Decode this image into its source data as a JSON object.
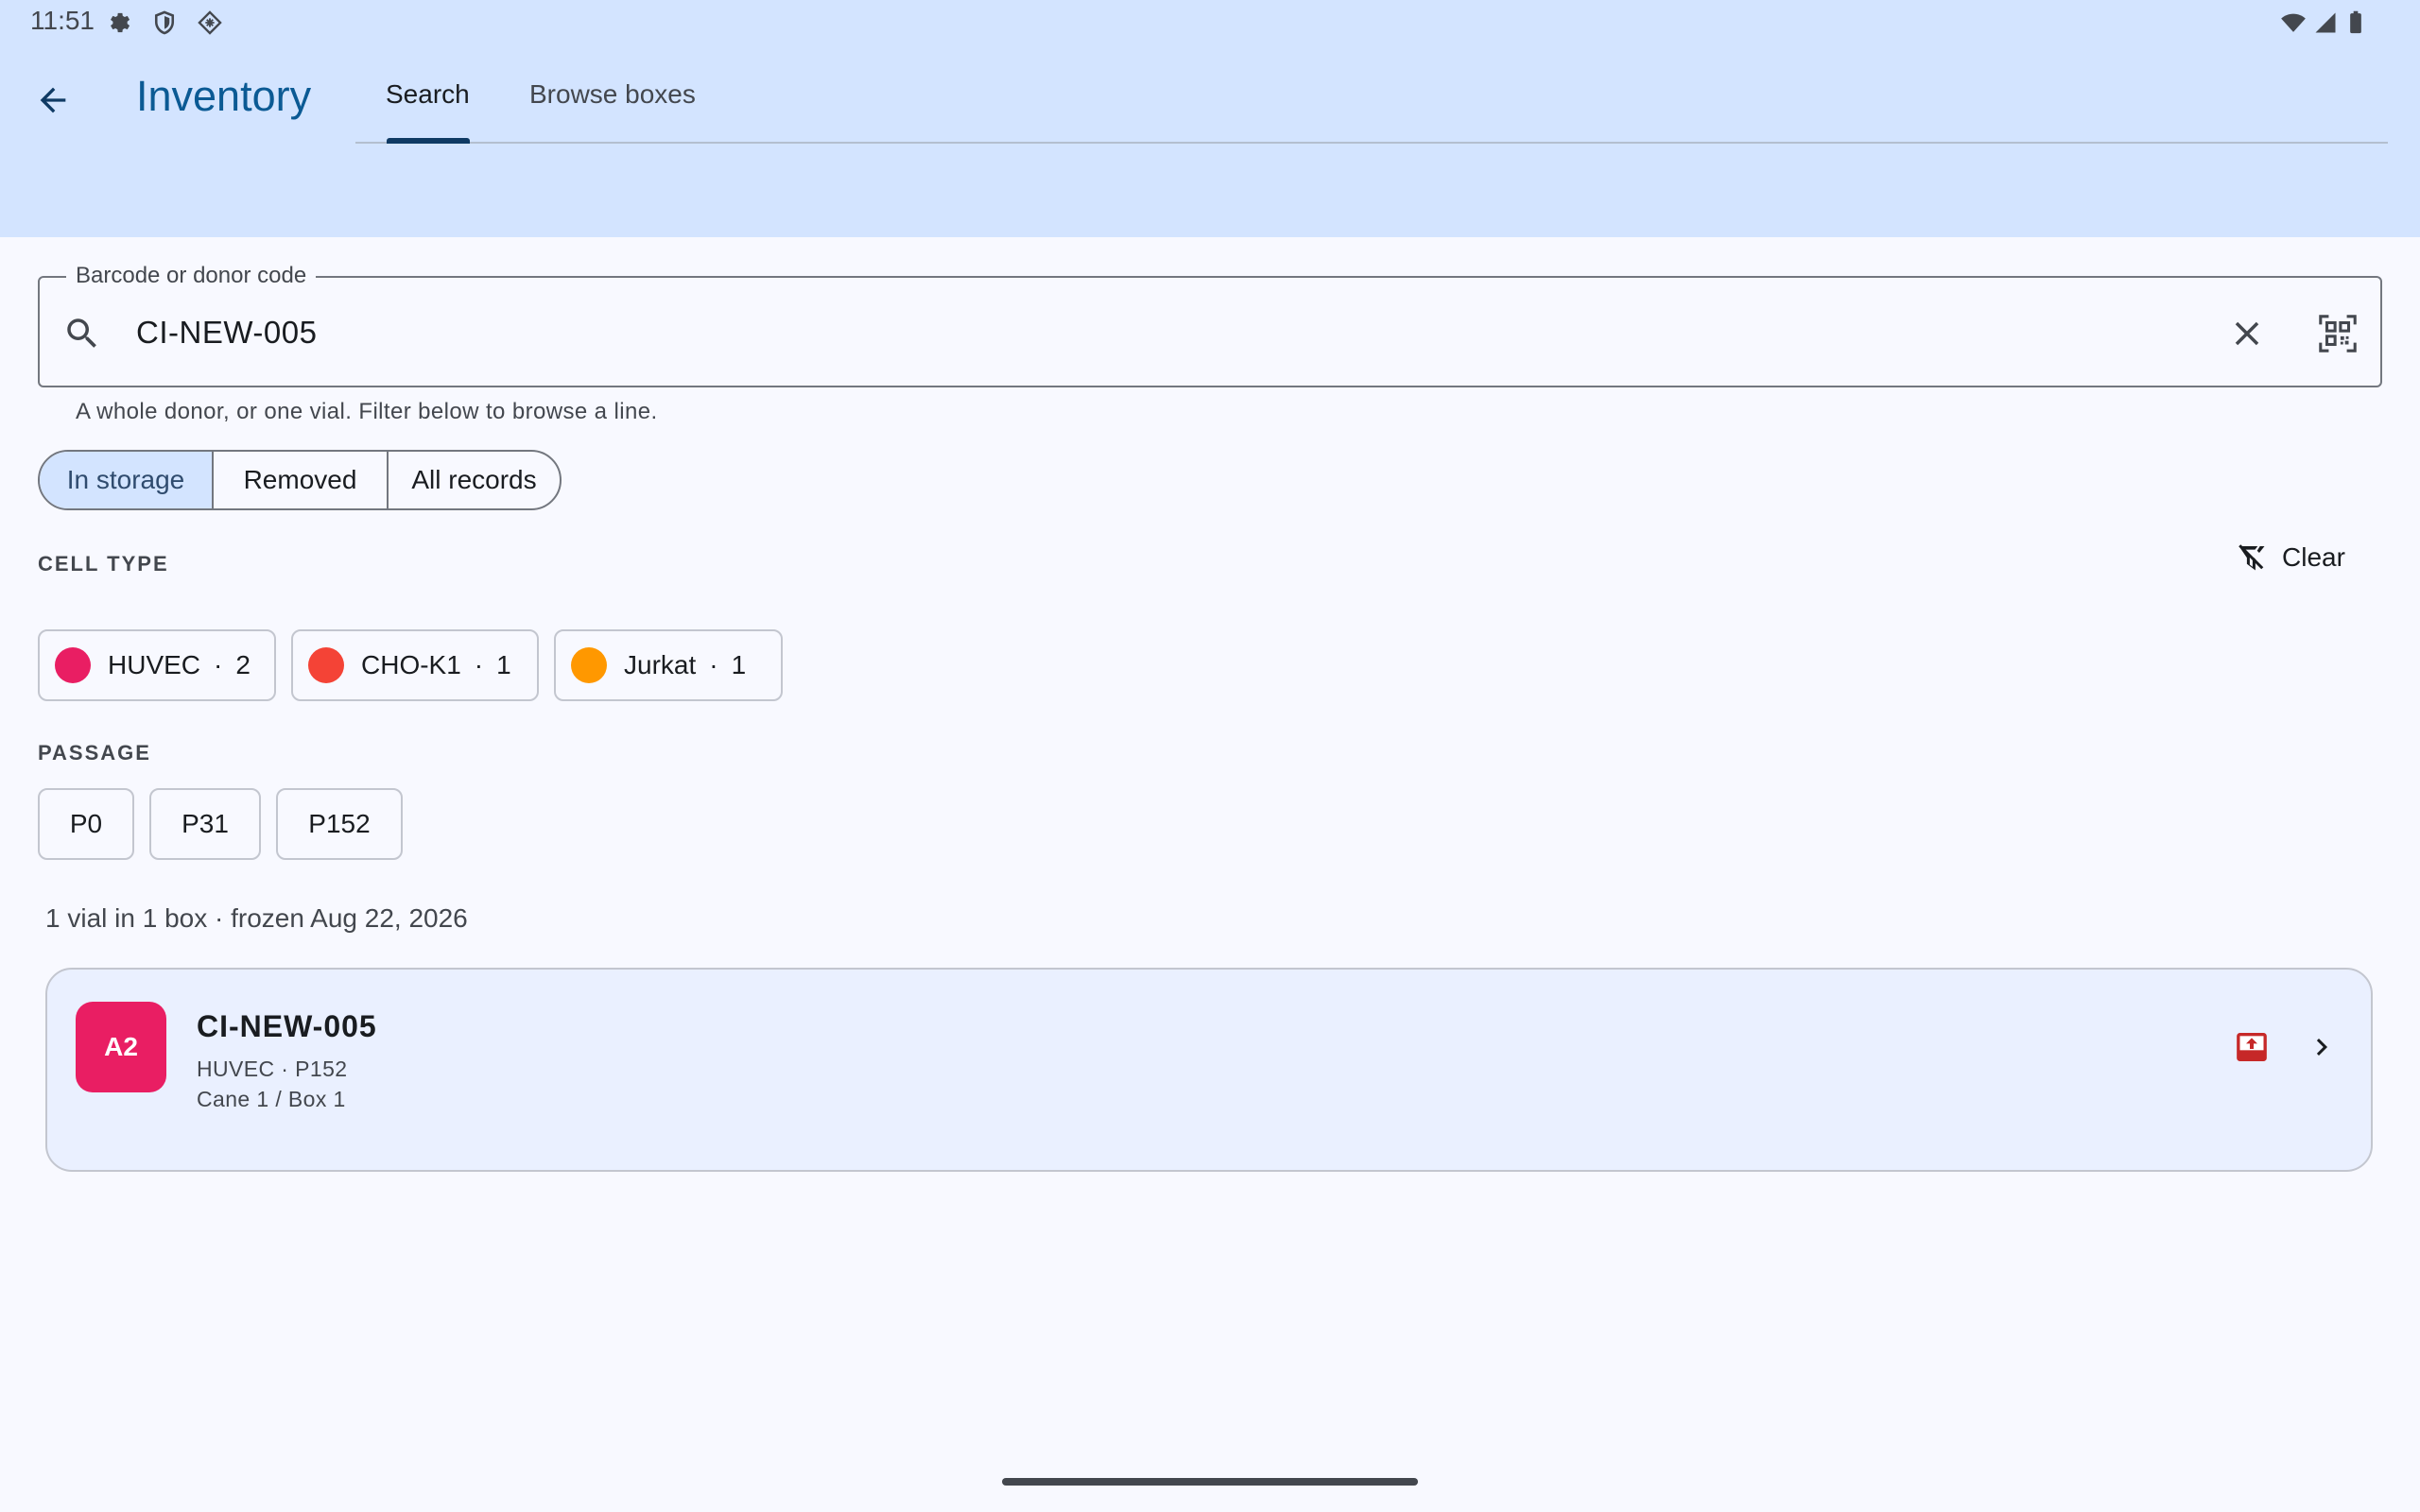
{
  "status_bar": {
    "time": "11:51",
    "icons": [
      "settings-icon",
      "shield-icon",
      "diamond-icon",
      "wifi-icon",
      "signal-icon",
      "battery-icon"
    ]
  },
  "app_bar": {
    "title": "Inventory",
    "tabs": [
      {
        "label": "Search",
        "active": true
      },
      {
        "label": "Browse boxes",
        "active": false
      }
    ]
  },
  "search": {
    "label": "Barcode or donor code",
    "value": "CI-NEW-005",
    "hint": "A whole donor, or one vial. Filter below to browse a line."
  },
  "storage_filter": {
    "options": [
      "In storage",
      "Removed",
      "All records"
    ],
    "selected": "In storage"
  },
  "cell_type": {
    "heading": "CELL TYPE",
    "clear_label": "Clear",
    "chips": [
      {
        "name": "HUVEC",
        "count": "2",
        "color": "#e91e63"
      },
      {
        "name": "CHO-K1",
        "count": "1",
        "color": "#f44336"
      },
      {
        "name": "Jurkat",
        "count": "1",
        "color": "#ff9800"
      }
    ]
  },
  "passage": {
    "heading": "PASSAGE",
    "chips": [
      "P0",
      "P31",
      "P152"
    ]
  },
  "results": {
    "summary": "1 vial in 1 box · frozen Aug 22, 2026",
    "items": [
      {
        "position": "A2",
        "code": "CI-NEW-005",
        "detail": "HUVEC · P152",
        "location": "Cane 1 / Box 1",
        "badge_color": "#e91e63",
        "action_icon": "remove-from-storage-icon"
      }
    ]
  },
  "colors": {
    "header_bg": "#d3e4ff",
    "title_blue": "#0b5a94",
    "card_bg": "#eaf0ff",
    "action_red": "#c62828"
  }
}
